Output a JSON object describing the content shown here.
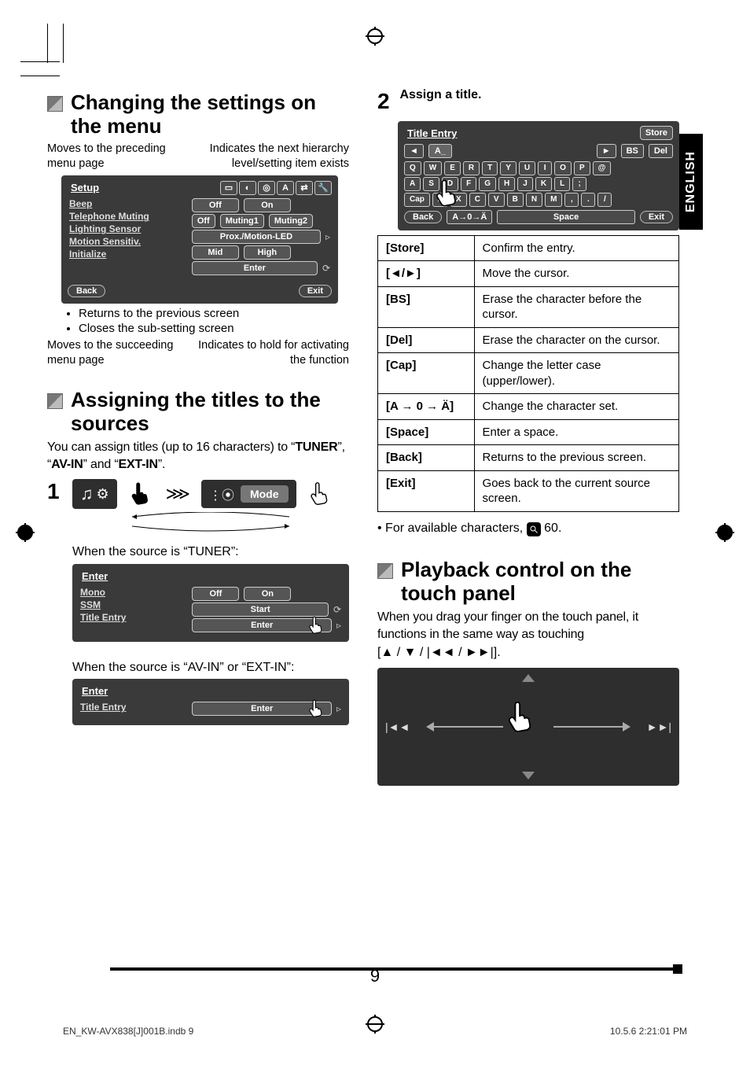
{
  "language_tab": "ENGLISH",
  "page_number": "9",
  "footer": {
    "file": "EN_KW-AVX838[J]001B.indb   9",
    "timestamp": "10.5.6   2:21:01 PM"
  },
  "left": {
    "h1": "Changing the settings on the menu",
    "callouts": {
      "top_left": "Moves to the preceding menu page",
      "top_right": "Indicates the next hierarchy level/setting item exists",
      "bottom_left": "Moves to the succeeding menu page",
      "bottom_right": "Indicates to hold for activating the function"
    },
    "setup_panel": {
      "title": "Setup",
      "items": [
        "Beep",
        "Telephone Muting",
        "Lighting Sensor",
        "Motion Sensitiv.",
        "Initialize"
      ],
      "opts": {
        "beep": [
          "Off",
          "On"
        ],
        "tel": [
          "Off",
          "Muting1",
          "Muting2"
        ],
        "light": "Prox./Motion-LED",
        "motion": [
          "Mid",
          "High"
        ],
        "init": "Enter"
      },
      "back": "Back",
      "exit": "Exit"
    },
    "setup_notes": [
      "Returns to the previous screen",
      "Closes the sub-setting screen"
    ],
    "h2": "Assigning the titles to the sources",
    "assign_intro_a": "You can assign titles (up to 16 characters) to “",
    "assign_intro_tuner": "TUNER",
    "assign_intro_b": "”, “",
    "assign_intro_avin": "AV-IN",
    "assign_intro_c": "” and “",
    "assign_intro_extin": "EXT-IN",
    "assign_intro_d": "”.",
    "mode_label": "Mode",
    "when_tuner": "When the source is “TUNER”:",
    "mode_tuner": {
      "title": "Enter",
      "items": [
        "Mono",
        "SSM",
        "Title Entry"
      ],
      "mono": [
        "Off",
        "On"
      ],
      "ssm": "Start"
    },
    "when_av_ext": "When the source is “AV-IN” or “EXT-IN”:",
    "mode_avext": {
      "title": "Enter",
      "items": [
        "Title Entry"
      ]
    }
  },
  "right": {
    "step2": "2",
    "step2_text": "Assign a title.",
    "title_entry_panel": {
      "title": "Title Entry",
      "store": "Store",
      "field_left": "A_",
      "bs": "BS",
      "del": "Del",
      "rows": [
        [
          "Q",
          "W",
          "E",
          "R",
          "T",
          "Y",
          "U",
          "I",
          "O",
          "P",
          "@"
        ],
        [
          "A",
          "S",
          "D",
          "F",
          "G",
          "H",
          "J",
          "K",
          "L",
          ";"
        ],
        [
          "Cap",
          "Z",
          "X",
          "C",
          "V",
          "B",
          "N",
          "M",
          ",",
          ".",
          "/"
        ]
      ],
      "back": "Back",
      "charset": "A→0→Ä",
      "space": "Space",
      "exit": "Exit"
    },
    "table": [
      [
        "[Store]",
        "Confirm the entry."
      ],
      [
        "[◄/►]",
        "Move the cursor."
      ],
      [
        "[BS]",
        "Erase the character before the cursor."
      ],
      [
        "[Del]",
        "Erase the character on the cursor."
      ],
      [
        "[Cap]",
        "Change the letter case (upper/lower)."
      ],
      [
        "[A → 0 → Ä]",
        "Change the character set."
      ],
      [
        "[Space]",
        "Enter a space."
      ],
      [
        "[Back]",
        "Returns to the previous screen."
      ],
      [
        "[Exit]",
        "Goes back to the current source screen."
      ]
    ],
    "note_chars_a": "For available characters, ",
    "note_chars_b": " 60.",
    "h3": "Playback control on the touch panel",
    "pb_text_a": "When you drag your finger on the touch panel, it functions in the same way as touching",
    "pb_text_b": "[▲ / ▼ / |◄◄ / ►►|].",
    "skip_prev": "|◄◄",
    "skip_next": "►►|"
  }
}
